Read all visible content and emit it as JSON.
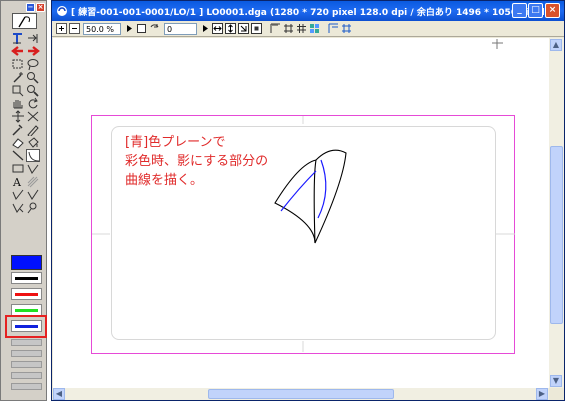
{
  "window": {
    "title": "[ 練習-001-001-0001/LO/1 ] LO0001.dga (1280 * 720 pixel 128.0 dpi / 余白あり 1496 * 1056 pixel)",
    "buttons": {
      "minimize": "_",
      "maximize": "□",
      "close": "×"
    }
  },
  "toolbar": {
    "zoom_value": "50.0 %",
    "frame_value": "0"
  },
  "canvas": {
    "note_lines": [
      "[青]色プレーンで",
      "彩色時、影にする部分の",
      "曲線を描く。"
    ]
  },
  "palette": {
    "header_buttons": {
      "minimize": "−",
      "close": "×"
    },
    "selected_tool": "brush-curve-tool",
    "swatch_colors": {
      "blue_selected": "#0010ff",
      "black": "#000000",
      "red": "#ee1111",
      "green": "#22e022",
      "blue": "#1122dd"
    },
    "highlight_color": "#e52121"
  },
  "colors": {
    "title_bar": "#0a5ae0",
    "frame_guide": "#e64ad7",
    "note_text": "#e02a2a",
    "curve_blue": "#1a1aff"
  }
}
